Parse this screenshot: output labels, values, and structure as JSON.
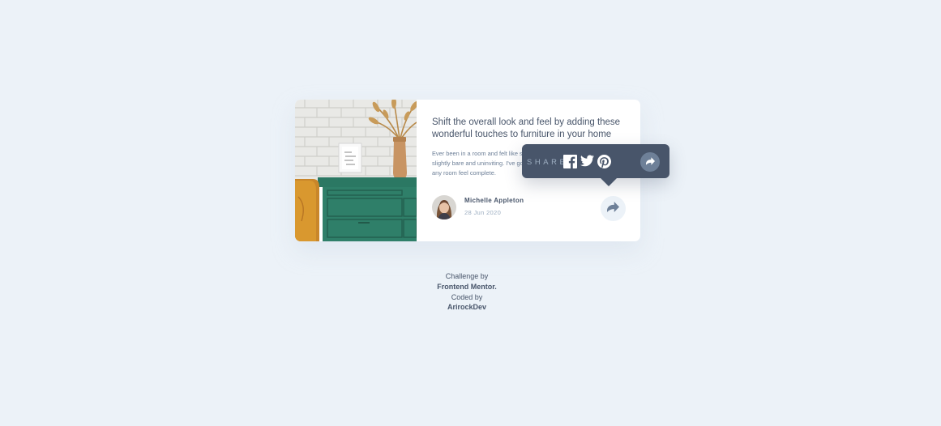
{
  "card": {
    "title": "Shift the overall look and feel by adding these wonderful touches to furniture in your home",
    "excerpt": "Ever been in a room and felt like something was missing? Perhaps it felt slightly bare and uninviting. I've got some simple tips to help you make any room feel complete.",
    "image_icon": "drawers-photo",
    "author": {
      "name": "Michelle Appleton",
      "date": "28 Jun 2020",
      "avatar_icon": "avatar-michelle"
    },
    "share_icon": "share-icon"
  },
  "share_tooltip": {
    "label": "SHARE",
    "networks": [
      {
        "name": "facebook",
        "icon": "facebook-icon"
      },
      {
        "name": "twitter",
        "icon": "twitter-icon"
      },
      {
        "name": "pinterest",
        "icon": "pinterest-icon"
      }
    ],
    "share_icon": "share-icon"
  },
  "attribution": {
    "line1": "Challenge by",
    "link1": "Frontend Mentor.",
    "line2": "Coded by",
    "link2": "ArirockDev"
  },
  "colors": {
    "background": "#ecf2f8",
    "card": "#ffffff",
    "dark_blue": "#48556a",
    "grayish_blue": "#6e8098",
    "light_grayish_blue": "#9eafc2"
  }
}
